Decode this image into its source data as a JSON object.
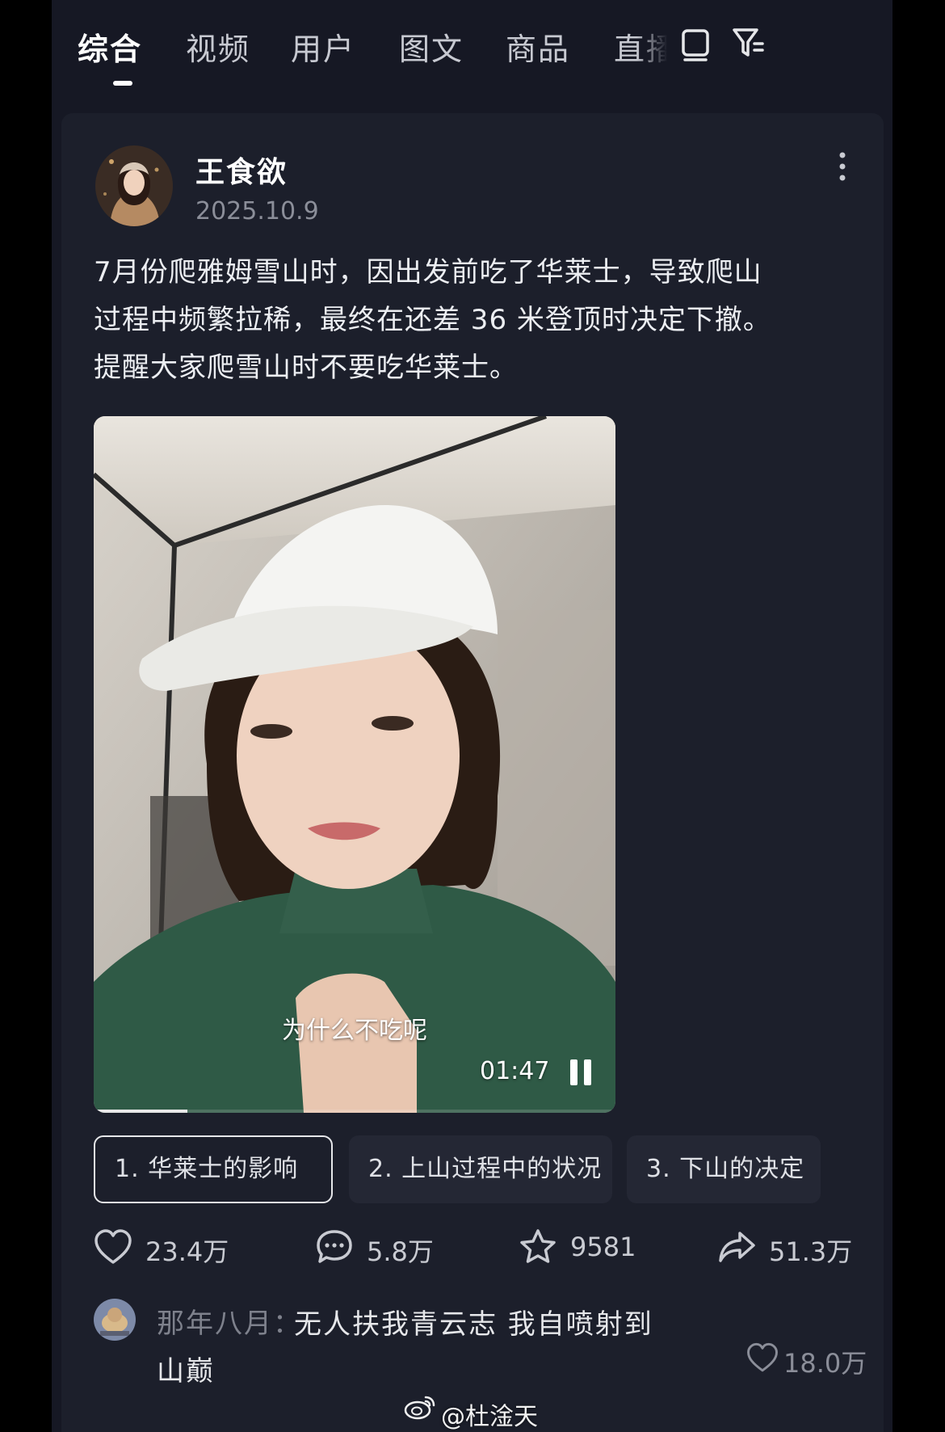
{
  "tabs": [
    {
      "label": "综合",
      "active": true
    },
    {
      "label": "视频"
    },
    {
      "label": "用户"
    },
    {
      "label": "图文"
    },
    {
      "label": "商品"
    },
    {
      "label": "直播"
    }
  ],
  "top_icons": [
    "layout-icon",
    "filter-icon"
  ],
  "post": {
    "author": "王食欲",
    "date": "2025.10.9",
    "text_lines": [
      "7月份爬雅姆雪山时，因出发前吃了华莱士，导致爬山",
      "过程中频繁拉稀，最终在还差 36 米登顶时决定下撤。",
      "提醒大家爬雪山时不要吃华莱士。"
    ]
  },
  "video": {
    "subtitle": "为什么不吃呢",
    "duration": "01:47",
    "progress": 0.18
  },
  "chapters": [
    {
      "label": "1. 华莱士的影响",
      "active": true
    },
    {
      "label": "2. 上山过程中的状况"
    },
    {
      "label": "3. 下山的决定"
    }
  ],
  "actions": {
    "likes": "23.4万",
    "comments": "5.8万",
    "favorites": "9581",
    "shares": "51.3万"
  },
  "top_comment": {
    "name": "那年八月：",
    "text": "无人扶我青云志 我自喷射到山巅",
    "likes": "18.0万"
  },
  "watermark": "@杜淦天",
  "colors": {
    "background": "#161824",
    "card": "#1c1f2b",
    "chip": "#242734"
  }
}
